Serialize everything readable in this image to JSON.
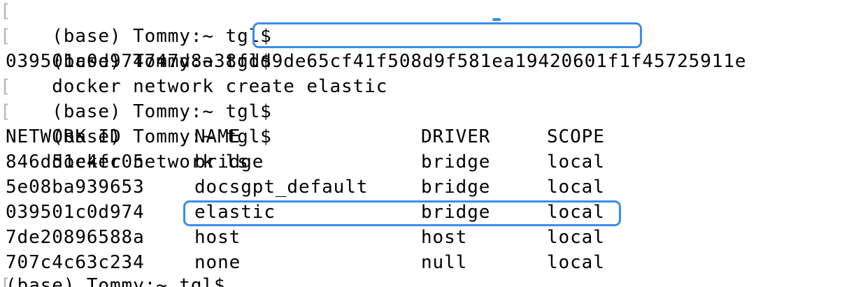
{
  "terminal": {
    "prompt": "(base) Tommy:~ tgl$",
    "lines": [
      {
        "prompt": "(base) Tommy:~ tgl$",
        "command": ""
      },
      {
        "prompt": "(base) Tommy:~ tgl$",
        "command": "docker network create elastic"
      },
      {
        "output": "039501c0d974747d8a38fdd9de65cf41f508d9f581ea19420601f1f45725911e"
      },
      {
        "prompt": "(base) Tommy:~ tgl$",
        "command": ""
      },
      {
        "prompt": "(base) Tommy:~ tgl$",
        "command": "docker network ls"
      }
    ],
    "table": {
      "headers": [
        "NETWORK ID",
        "NAME",
        "DRIVER",
        "SCOPE"
      ],
      "rows": [
        {
          "id": "846d51e4fc05",
          "name": "bridge",
          "driver": "bridge",
          "scope": "local"
        },
        {
          "id": "5e08ba939653",
          "name": "docsgpt_default",
          "driver": "bridge",
          "scope": "local"
        },
        {
          "id": "039501c0d974",
          "name": "elastic",
          "driver": "bridge",
          "scope": "local"
        },
        {
          "id": "7de20896588a",
          "name": "host",
          "driver": "host",
          "scope": "local"
        },
        {
          "id": "707c4c63c234",
          "name": "none",
          "driver": "null",
          "scope": "local"
        }
      ]
    },
    "highlight_color": "#3b8ced"
  }
}
